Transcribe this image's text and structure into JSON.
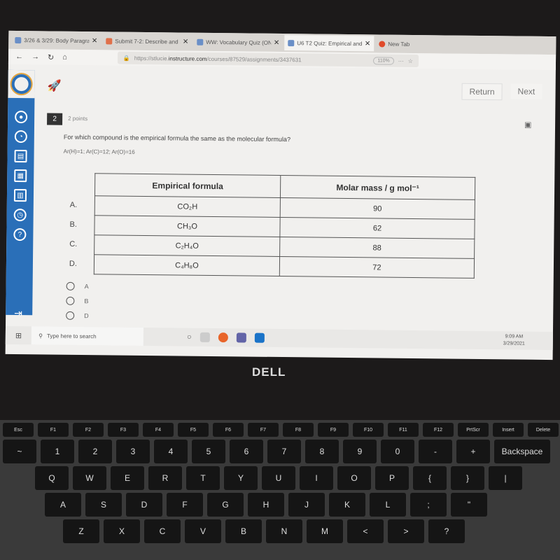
{
  "browser": {
    "tabs": [
      {
        "title": "3/26 & 3/29: Body Paragraph",
        "active": false
      },
      {
        "title": "Submit 7-2: Describe and Sol",
        "active": false
      },
      {
        "title": "WW: Vocabulary Quiz (ONLY",
        "active": false
      },
      {
        "title": "U6 T2 Quiz: Empirical and M",
        "active": true
      },
      {
        "title": "New Tab",
        "active": false
      }
    ],
    "url_prefix": "https://stlucie.",
    "url_domain": "instructure.com",
    "url_path": "/courses/87529/assignments/3437631",
    "zoom": "110%"
  },
  "header": {
    "return_label": "Return",
    "next_label": "Next"
  },
  "question": {
    "number": "2",
    "points": "2 points",
    "text": "For which compound is the empirical formula the same as the molecular formula?",
    "masses": "Ar(H)=1; Ar(C)=12; Ar(O)=16",
    "table": {
      "headers": [
        "Empirical formula",
        "Molar mass / g mol⁻¹"
      ],
      "rows": [
        {
          "label": "A.",
          "formula": "CO₂H",
          "mass": "90"
        },
        {
          "label": "B.",
          "formula": "CH₃O",
          "mass": "62"
        },
        {
          "label": "C.",
          "formula": "C₂H₄O",
          "mass": "88"
        },
        {
          "label": "D.",
          "formula": "C₄H₈O",
          "mass": "72"
        }
      ]
    },
    "options": [
      "A",
      "B",
      "D"
    ]
  },
  "taskbar": {
    "search_placeholder": "Type here to search",
    "time": "9:09 AM",
    "date": "3/29/2021"
  },
  "laptop": {
    "brand": "DELL"
  },
  "keyboard": {
    "rows": [
      [
        "Esc",
        "F1",
        "F2",
        "F3",
        "F4",
        "F5",
        "F6",
        "F7",
        "F8",
        "F9",
        "F10",
        "F11",
        "F12",
        "PrtScr",
        "Insert",
        "Delete"
      ],
      [
        "~",
        "1",
        "2",
        "3",
        "4",
        "5",
        "6",
        "7",
        "8",
        "9",
        "0",
        "-",
        "+",
        "Backspace"
      ],
      [
        "Q",
        "W",
        "E",
        "R",
        "T",
        "Y",
        "U",
        "I",
        "O",
        "P",
        "{",
        "}",
        "|"
      ],
      [
        "A",
        "S",
        "D",
        "F",
        "G",
        "H",
        "J",
        "K",
        "L",
        ";",
        "\""
      ],
      [
        "Z",
        "X",
        "C",
        "V",
        "B",
        "N",
        "M",
        "<",
        ">",
        "?"
      ]
    ]
  }
}
